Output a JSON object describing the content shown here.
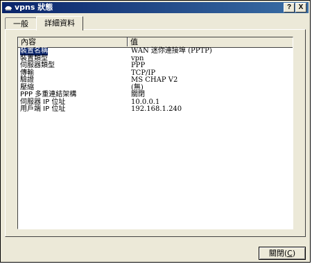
{
  "window": {
    "title": "vpns 狀態",
    "help_label": "?",
    "close_label": "X"
  },
  "tabs": [
    {
      "label": "一般"
    },
    {
      "label": "詳細資料"
    }
  ],
  "list": {
    "columns": [
      "內容",
      "值"
    ],
    "rows": [
      {
        "key": "裝置名稱",
        "value": "WAN 迷你連接埠 (PPTP)"
      },
      {
        "key": "裝置類型",
        "value": "vpn"
      },
      {
        "key": "伺服器類型",
        "value": "PPP"
      },
      {
        "key": "傳輸",
        "value": "TCP/IP"
      },
      {
        "key": "驗證",
        "value": "MS CHAP V2"
      },
      {
        "key": "壓縮",
        "value": "(無)"
      },
      {
        "key": "PPP 多重連結架構",
        "value": "關閉"
      },
      {
        "key": "伺服器 IP 位址",
        "value": "10.0.0.1"
      },
      {
        "key": "用戶端 IP 位址",
        "value": "192.168.1.240"
      }
    ]
  },
  "footer": {
    "close_label": "關閉(",
    "close_hotkey": "C",
    "close_suffix": ")"
  },
  "colors": {
    "titlebar": "#0a246a",
    "selection": "#0a246a",
    "face": "#ece9d8"
  }
}
